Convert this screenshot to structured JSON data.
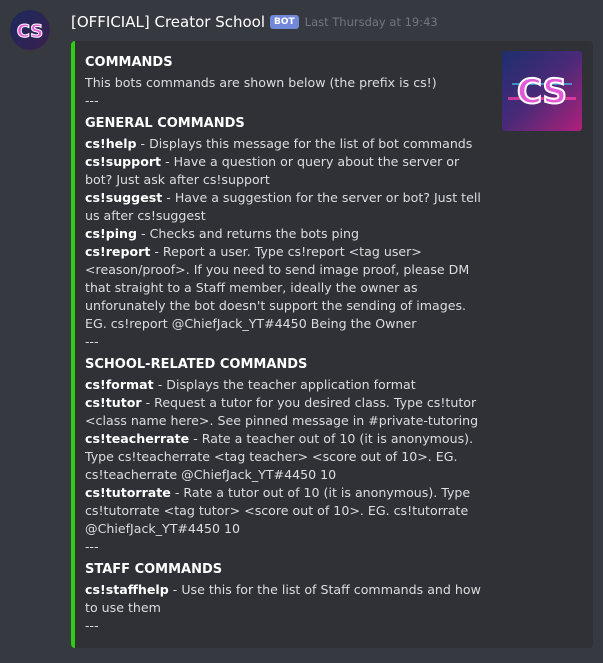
{
  "message": {
    "author": "[OFFICIAL] Creator School",
    "bot_tag": "BOT",
    "timestamp": "Last Thursday at 19:43",
    "avatar_icon": "creator-school-logo-icon",
    "avatar_text": "CS"
  },
  "embed": {
    "accent_color": "#2ecc12",
    "thumbnail_text": "CS",
    "title": "COMMANDS",
    "description": "This bots commands are shown below (the prefix is cs!)",
    "separator": "---",
    "sections": [
      {
        "title": "GENERAL COMMANDS",
        "commands": [
          {
            "name": "cs!help",
            "desc": " - Displays this message for the list of bot commands"
          },
          {
            "name": "cs!support",
            "desc": " - Have a question or query about the server or bot? Just ask after cs!support"
          },
          {
            "name": "cs!suggest",
            "desc": " - Have a suggestion for the server or bot? Just tell us after cs!suggest"
          },
          {
            "name": "cs!ping",
            "desc": " - Checks and returns the bots ping"
          },
          {
            "name": "cs!report",
            "desc": " - Report a user. Type cs!report <tag user> <reason/proof>. If you need to send image proof, please DM that straight to a Staff member, ideally the owner as unforunately the bot doesn't support the sending of images. EG. cs!report @ChiefJack_YT#4450 Being the Owner"
          }
        ],
        "separator": "---"
      },
      {
        "title": "SCHOOL-RELATED COMMANDS",
        "commands": [
          {
            "name": "cs!format",
            "desc": " - Displays the teacher application format"
          },
          {
            "name": "cs!tutor",
            "desc": " - Request a tutor for you desired class. Type cs!tutor <class name here>. See pinned message in #private-tutoring"
          },
          {
            "name": "cs!teacherrate",
            "desc": " - Rate a teacher out of 10 (it is anonymous). Type cs!teacherrate <tag teacher> <score out of 10>. EG. cs!teacherrate @ChiefJack_YT#4450 10"
          },
          {
            "name": "cs!tutorrate",
            "desc": " - Rate a tutor out of 10 (it is anonymous). Type cs!tutorrate <tag tutor> <score out of 10>. EG. cs!tutorrate @ChiefJack_YT#4450 10"
          }
        ],
        "separator": "---"
      },
      {
        "title": "STAFF COMMANDS",
        "commands": [
          {
            "name": "cs!staffhelp",
            "desc": " - Use this for the list of Staff commands and how to use them"
          }
        ],
        "separator": "---"
      }
    ]
  }
}
